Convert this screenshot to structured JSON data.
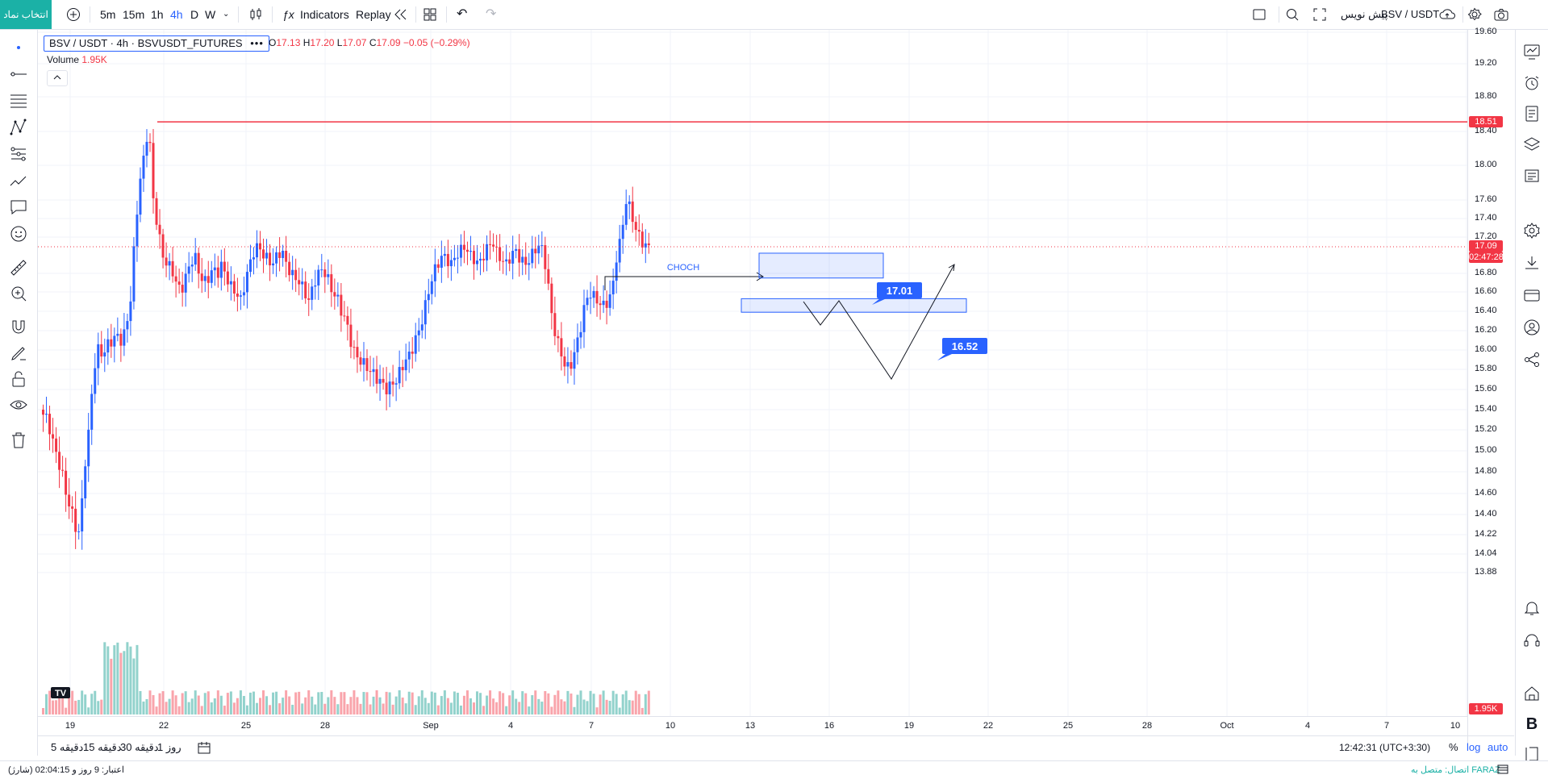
{
  "toolbar": {
    "select_symbol_button": "انتخاب نماد",
    "intervals": [
      "5m",
      "15m",
      "1h",
      "4h",
      "D",
      "W"
    ],
    "active_interval": "4h",
    "indicators_label": "Indicators",
    "replay_label": "Replay",
    "symbol_title": "BSV / USDT",
    "symbol_subtitle": "پیش نویس"
  },
  "legend": {
    "symbol_line": "BSV / USDT · 4h · BSVUSDT_FUTURES",
    "more": "•••",
    "open_label": "O",
    "open": "17.13",
    "high_label": "H",
    "high": "17.20",
    "low_label": "L",
    "low": "17.07",
    "close_label": "C",
    "close": "17.09",
    "change": "−0.05 (−0.29%)",
    "volume_label": "Volume",
    "volume_value": "1.95K",
    "collapse_icon": "chevron-up"
  },
  "price_scale": {
    "ticks": [
      "19.60",
      "19.20",
      "18.80",
      "18.40",
      "18.00",
      "17.60",
      "17.40",
      "17.20",
      "16.80",
      "16.60",
      "16.40",
      "16.20",
      "16.00",
      "15.80",
      "15.60",
      "15.40",
      "15.20",
      "15.00",
      "14.80",
      "14.60",
      "14.40",
      "14.22",
      "14.04",
      "13.88"
    ],
    "line_label": "18.51",
    "last_price": "17.09",
    "countdown": "02:47:28",
    "volume_label": "1.95K"
  },
  "time_scale": {
    "ticks": [
      "19",
      "22",
      "25",
      "28",
      "Sep",
      "4",
      "7",
      "10",
      "13",
      "16",
      "19",
      "22",
      "25",
      "28",
      "Oct",
      "4",
      "7",
      "10"
    ]
  },
  "drawings": {
    "choch_label": "CHOCH",
    "zone1_label": "17.01",
    "zone2_label": "16.52"
  },
  "bottom_bar": {
    "ranges": [
      "5 دقیقه",
      "15 دقیقه",
      "30 دقیقه",
      "1 روز"
    ],
    "clock": "12:42:31 (UTC+3:30)",
    "percent": "%",
    "log": "log",
    "auto": "auto"
  },
  "status_bar": {
    "credit": "اعتبار: 9 روز و 02:04:15 (شارژ)",
    "connection": "اتصال: متصل به FARAZ"
  },
  "colors": {
    "up": "#26a69a",
    "candle_up": "#2962ff",
    "down": "#f23645",
    "accent": "#2962ff",
    "teal_button": "#1bb1a6"
  },
  "chart_data": {
    "type": "candlestick",
    "symbol": "BSV / USDT",
    "interval": "4h",
    "ylim": [
      13.88,
      19.6
    ],
    "horizontal_line": 18.51,
    "current_price": 17.09,
    "zones": [
      {
        "label": "17.01",
        "low": 16.75,
        "high": 17.02
      },
      {
        "label": "16.52",
        "low": 16.39,
        "high": 16.53
      }
    ],
    "x_ticks": [
      "19",
      "22",
      "25",
      "28",
      "Sep",
      "4",
      "7",
      "10",
      "13",
      "16",
      "19",
      "22",
      "25",
      "28",
      "Oct",
      "4",
      "7",
      "10"
    ]
  }
}
